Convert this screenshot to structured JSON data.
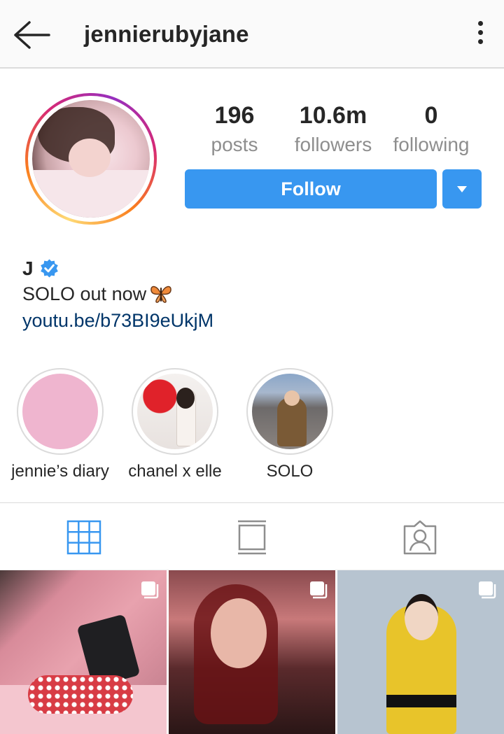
{
  "header": {
    "back_icon": "arrow-left-icon",
    "username": "jennierubyjane",
    "menu_icon": "more-vertical-icon"
  },
  "profile": {
    "stats": [
      {
        "value": "196",
        "label": "posts"
      },
      {
        "value": "10.6m",
        "label": "followers"
      },
      {
        "value": "0",
        "label": "following"
      }
    ],
    "follow_label": "Follow",
    "follow_color": "#3897f0",
    "name": "J",
    "bio": "SOLO out now",
    "link": "youtu.be/b73BI9eUkjM"
  },
  "highlights": [
    {
      "label": "jennie’s diary"
    },
    {
      "label": "chanel x elle"
    },
    {
      "label": "SOLO"
    }
  ],
  "tabs": [
    {
      "icon": "grid-icon",
      "active": true
    },
    {
      "icon": "feed-icon",
      "active": false
    },
    {
      "icon": "tagged-icon",
      "active": false
    }
  ],
  "colors": {
    "accent": "#3897f0",
    "link": "#003569",
    "muted": "#8e8e8e"
  }
}
